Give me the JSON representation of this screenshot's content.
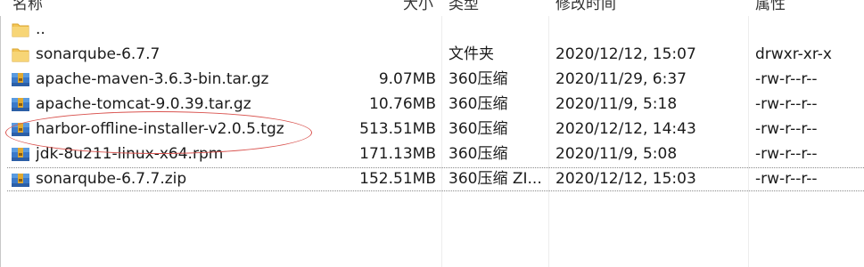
{
  "columns": {
    "name": "名称",
    "size": "大小",
    "type": "类型",
    "modified": "修改时间",
    "attributes": "属性"
  },
  "rows": [
    {
      "name": "..",
      "size": "",
      "type": "",
      "modified": "",
      "attributes": "",
      "icon": "folder-icon"
    },
    {
      "name": "sonarqube-6.7.7",
      "size": "",
      "type": "文件夹",
      "modified": "2020/12/12, 15:07",
      "attributes": "drwxr-xr-x",
      "icon": "folder-icon"
    },
    {
      "name": "apache-maven-3.6.3-bin.tar.gz",
      "size": "9.07MB",
      "type": "360压缩",
      "modified": "2020/11/29, 6:37",
      "attributes": "-rw-r--r--",
      "icon": "archive-icon"
    },
    {
      "name": "apache-tomcat-9.0.39.tar.gz",
      "size": "10.76MB",
      "type": "360压缩",
      "modified": "2020/11/9, 5:18",
      "attributes": "-rw-r--r--",
      "icon": "archive-icon"
    },
    {
      "name": "harbor-offline-installer-v2.0.5.tgz",
      "size": "513.51MB",
      "type": "360压缩",
      "modified": "2020/12/12, 14:43",
      "attributes": "-rw-r--r--",
      "icon": "archive-icon"
    },
    {
      "name": "jdk-8u211-linux-x64.rpm",
      "size": "171.13MB",
      "type": "360压缩",
      "modified": "2020/11/9, 5:08",
      "attributes": "-rw-r--r--",
      "icon": "archive-icon"
    },
    {
      "name": "sonarqube-6.7.7.zip",
      "size": "152.51MB",
      "type": "360压缩 ZI...",
      "modified": "2020/12/12, 15:03",
      "attributes": "-rw-r--r--",
      "icon": "archive-icon",
      "selected": true
    }
  ],
  "colors": {
    "annotation": "#d9534f",
    "folder": "#f3c454",
    "archive_blue": "#3a79c9",
    "archive_gold": "#e0a931"
  }
}
